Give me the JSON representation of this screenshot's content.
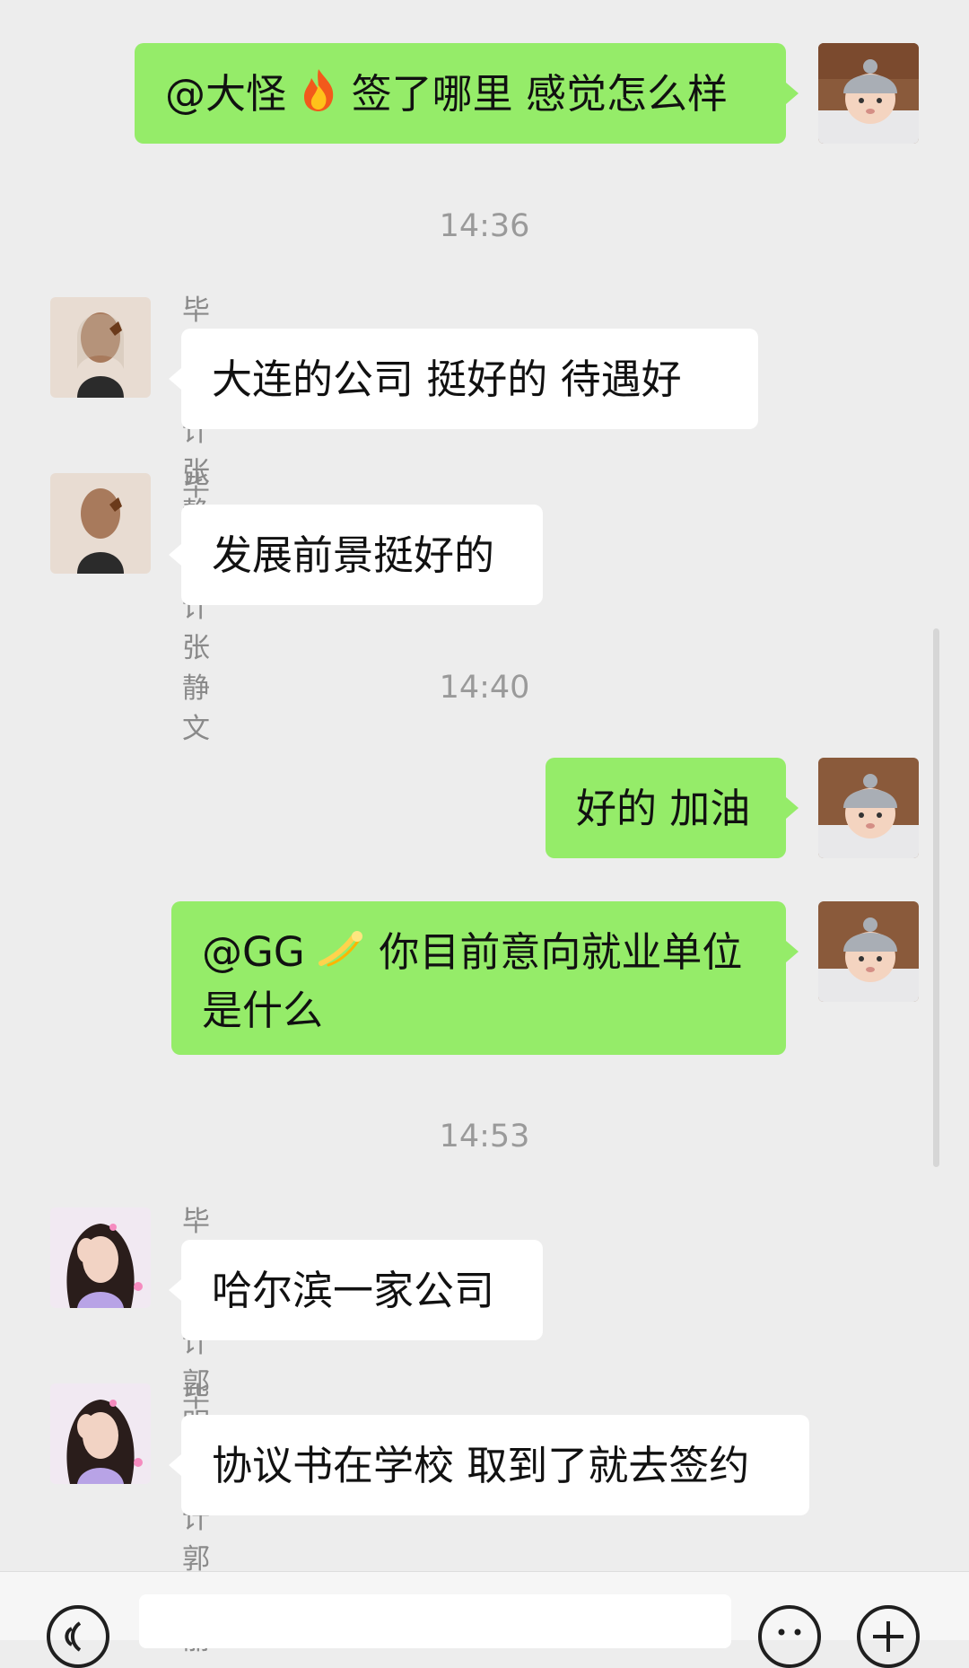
{
  "messages": [
    {
      "from": "me",
      "text_main": "@大怪",
      "emoji": "fire-emoji",
      "text_after": " 签了哪里 感觉怎么样"
    },
    {
      "type": "time",
      "text": "14:36"
    },
    {
      "from": "other",
      "sender": "毕业设计 张静文",
      "text": "大连的公司  挺好的  待遇好"
    },
    {
      "from": "other",
      "sender": "毕业设计 张静文",
      "text": "发展前景挺好的"
    },
    {
      "type": "time",
      "text": "14:40"
    },
    {
      "from": "me",
      "text": "好的 加油"
    },
    {
      "from": "me",
      "line1_prefix": "@GG",
      "emoji": "shooting-star-emoji",
      "line1_after": " 你目前意向就业单位",
      "line2": "是什么"
    },
    {
      "type": "time",
      "text": "14:53"
    },
    {
      "from": "other",
      "sender": "毕业设计 郭明丽",
      "text": "哈尔滨一家公司"
    },
    {
      "from": "other",
      "sender": "毕业设计 郭明丽",
      "text": "协议书在学校 取到了就去签约"
    }
  ],
  "colors": {
    "my_bubble": "#95ec69",
    "other_bubble": "#ffffff",
    "background": "#ededed"
  },
  "icons": {
    "voice": "voice-icon",
    "emoji_face": "smiley-icon",
    "plus": "plus-icon"
  }
}
